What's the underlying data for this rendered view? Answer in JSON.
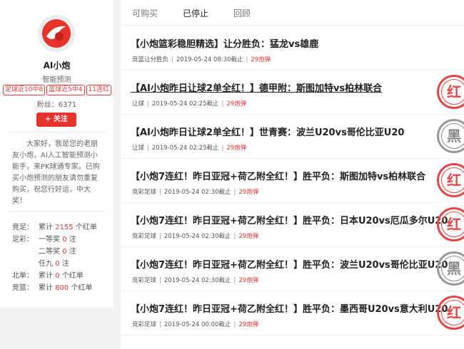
{
  "sidebar": {
    "name": "AI小炮",
    "subtitle": "智能预测",
    "tags": [
      "足球近10中8",
      "篮球近5中4",
      "11连红"
    ],
    "fans": "粉丝：6371",
    "follow_label": "+ 关注",
    "bio": "大家好，我是您的老朋友小炮，AI人工智能预测小能手，来PK球通专家。已购买小炮预测的朋友请勿重复购买，祝您行好运，中大奖！",
    "stats": [
      {
        "cat": "竞足：",
        "pre": "累计",
        "num": "2155",
        "post": "个红单"
      },
      {
        "cat": "足彩：",
        "pre": "一等奖",
        "num": "0",
        "post": "注"
      },
      {
        "cat": "",
        "pre": "二等奖",
        "num": "0",
        "post": "注"
      },
      {
        "cat": "",
        "pre": "任九",
        "num": "0",
        "post": "注"
      },
      {
        "cat": "北单：",
        "pre": "累计",
        "num": "0",
        "post": "个红单"
      },
      {
        "cat": "竞篮：",
        "pre": "累计",
        "num": "800",
        "post": "个红单"
      }
    ],
    "colors": {
      "accent": "#e8332b",
      "red": "#e03b3b"
    }
  },
  "tabs": [
    "可购买",
    "已停止",
    "回顾"
  ],
  "active_tab": "已停止",
  "items": [
    {
      "title": "【小炮篮彩稳胆精选】让分胜负：猛龙vs雄鹿",
      "type": "竞篮让分胜负",
      "time": "2019-05-24 08:30截止",
      "price": "29炮弹",
      "stamp": "",
      "underline": false
    },
    {
      "title": "【AI小炮昨日让球2单全红！】德甲附：斯图加特vs柏林联合",
      "type": "让球",
      "time": "2019-05-24 02:25截止",
      "price": "29炮弹",
      "stamp": "红",
      "underline": true
    },
    {
      "title": "【AI小炮昨日让球2单全红！】世青赛：波兰U20vs哥伦比亚U20",
      "type": "让球",
      "time": "2019-05-24 02:25截止",
      "price": "29炮弹",
      "stamp": "黑",
      "underline": false
    },
    {
      "title": "【小炮7连红！昨日亚冠+荷乙附全红！】胜平负：斯图加特vs柏林联合",
      "type": "竞彩足球",
      "time": "2019-05-24 02:30截止",
      "price": "29炮弹",
      "stamp": "红",
      "underline": false
    },
    {
      "title": "【小炮7连红！昨日亚冠+荷乙附全红！】胜平负：日本U20vs厄瓜多尔U20",
      "type": "竞彩足球",
      "time": "2019-05-24 02:30截止",
      "price": "29炮弹",
      "stamp": "红",
      "underline": false
    },
    {
      "title": "【小炮7连红！昨日亚冠+荷乙附全红！】胜平负：波兰U20vs哥伦比亚U20",
      "type": "竞彩足球",
      "time": "2019-05-24 02:30截止",
      "price": "29炮弹",
      "stamp": "黑",
      "underline": false
    },
    {
      "title": "【小炮7连红！昨日亚冠+荷乙附全红！】胜平负：墨西哥U20vs意大利U20",
      "type": "竞彩足球",
      "time": "2019-05-24 00:00截止",
      "price": "29炮弹",
      "stamp": "红",
      "underline": false
    }
  ]
}
